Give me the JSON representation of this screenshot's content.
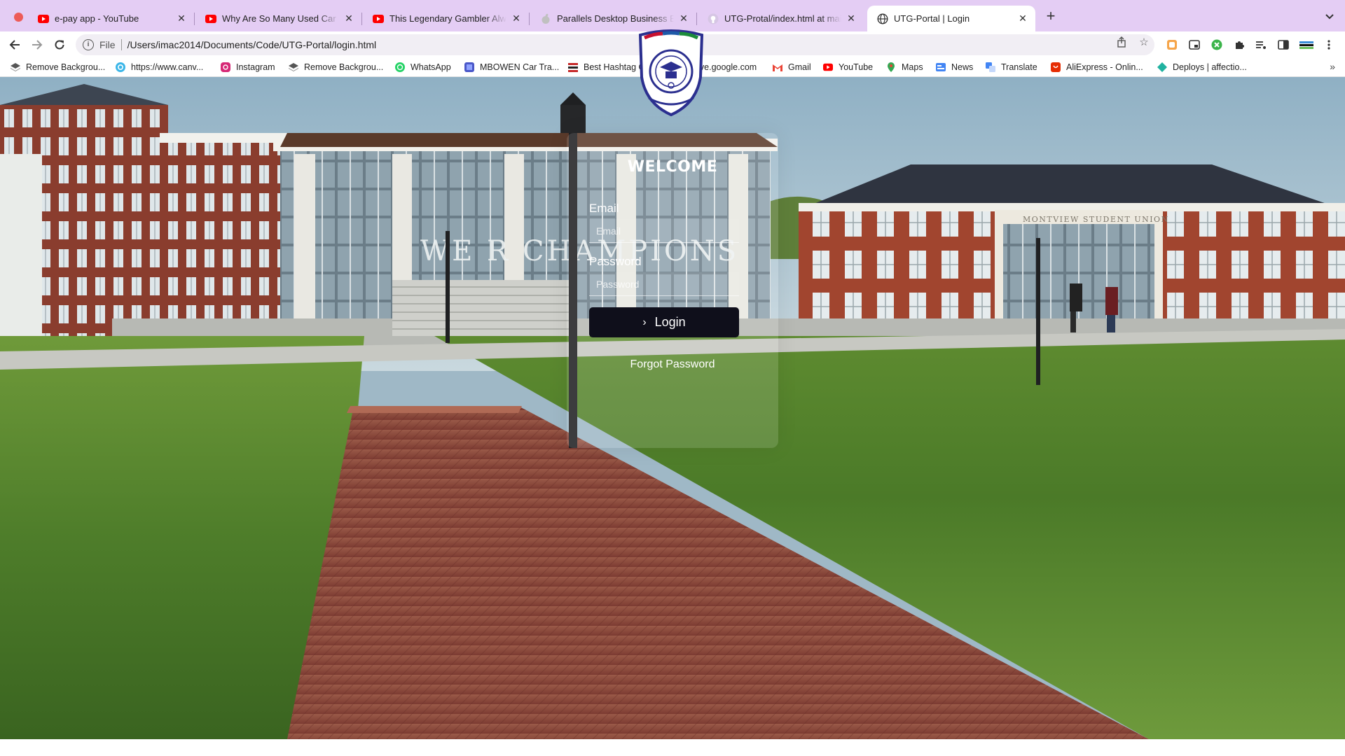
{
  "browser": {
    "tabs": [
      {
        "title": "e-pay app - YouTube",
        "icon": "youtube-icon"
      },
      {
        "title": "Why Are So Many Used Car Stores Going Out of Business",
        "icon": "youtube-icon"
      },
      {
        "title": "This Legendary Gambler Always Wins",
        "icon": "youtube-icon"
      },
      {
        "title": "Parallels Desktop Business Edition",
        "icon": "apple-icon"
      },
      {
        "title": "UTG-Protal/index.html at main",
        "icon": "github-icon"
      },
      {
        "title": "UTG-Portal | Login",
        "icon": "globe-icon"
      }
    ],
    "active_tab_index": 5,
    "address": {
      "scheme_label": "File",
      "url": "/Users/imac2014/Documents/Code/UTG-Portal/login.html"
    },
    "bookmarks": [
      {
        "label": "Remove Backgrou...",
        "icon": "removebg-icon"
      },
      {
        "label": "https://www.canv...",
        "icon": "canva-icon"
      },
      {
        "label": "Instagram",
        "icon": "instagram-icon"
      },
      {
        "label": "Remove Backgrou...",
        "icon": "removebg-icon"
      },
      {
        "label": "WhatsApp",
        "icon": "whatsapp-icon"
      },
      {
        "label": "MBOWEN Car Tra...",
        "icon": "bookmark-app-icon"
      },
      {
        "label": "Best Hashtag Gen...",
        "icon": "hashtag-icon"
      },
      {
        "label": "drive.google.com",
        "icon": "google-drive-icon"
      },
      {
        "label": "Gmail",
        "icon": "gmail-icon"
      },
      {
        "label": "YouTube",
        "icon": "youtube-icon"
      },
      {
        "label": "Maps",
        "icon": "maps-icon"
      },
      {
        "label": "News",
        "icon": "news-icon"
      },
      {
        "label": "Translate",
        "icon": "translate-icon"
      },
      {
        "label": "AliExpress - Onlin...",
        "icon": "aliexpress-icon"
      },
      {
        "label": "Deploys | affectio...",
        "icon": "netlify-icon"
      }
    ],
    "bookmarks_overflow": "»"
  },
  "login": {
    "heading": "WELCOME",
    "email_label": "Email",
    "email_placeholder": "Email",
    "password_label": "Password",
    "password_placeholder": "Password",
    "button_label": "Login",
    "forgot_label": "Forgot Password"
  },
  "background": {
    "building_banner": "WE R CHAMPIONS",
    "building_sign": "MONTVIEW STUDENT UNION"
  },
  "colors": {
    "tabstrip": "#e4cdf4",
    "button": "#0f0f1b",
    "crest_stroke": "#2b2f8f"
  }
}
